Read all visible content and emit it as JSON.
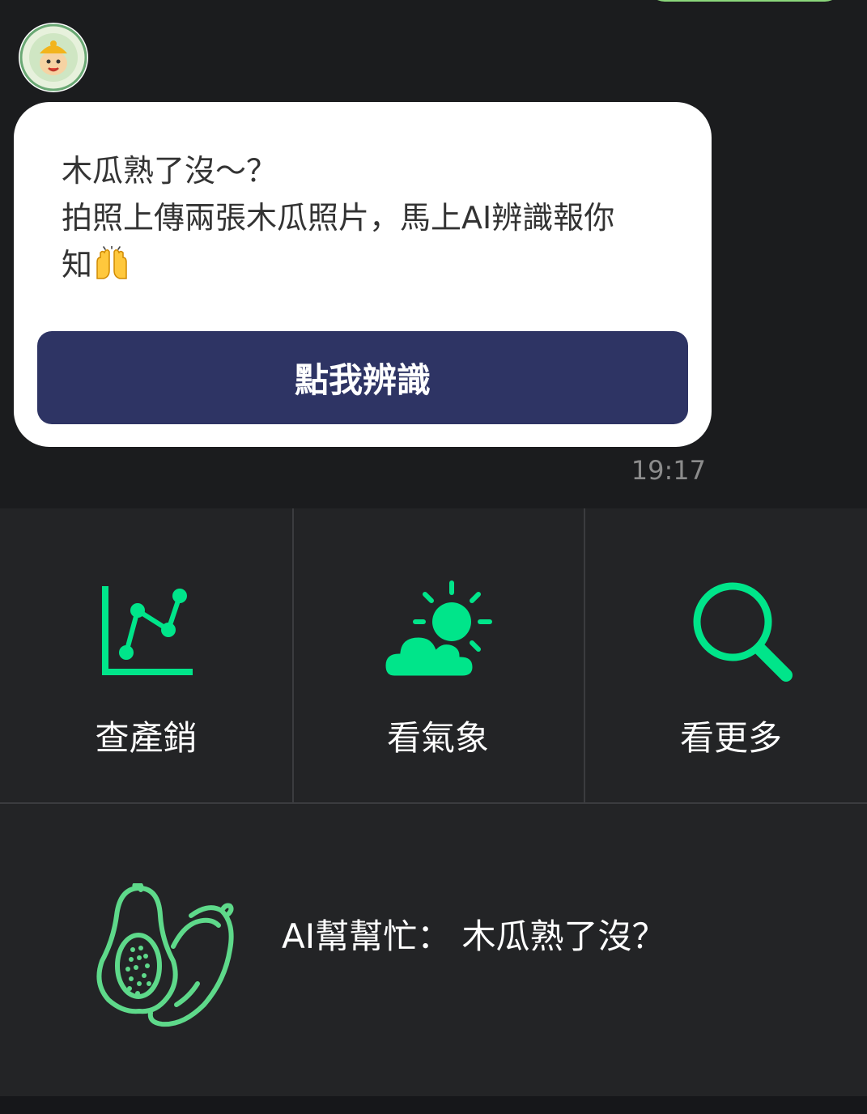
{
  "chat": {
    "message_text": "木瓜熟了沒～？\n拍照上傳兩張木瓜照片，馬上AI辨識報你\n知",
    "emoji_icon": "raising-hands-icon",
    "button_label": "點我辨識",
    "timestamp": "19:17"
  },
  "menu": {
    "items": [
      {
        "label": "查產銷",
        "icon": "line-chart-icon"
      },
      {
        "label": "看氣象",
        "icon": "weather-sun-cloud-icon"
      },
      {
        "label": "看更多",
        "icon": "search-icon"
      },
      {
        "label": "AI幫幫忙： 木瓜熟了沒？",
        "icon": "papaya-icon"
      }
    ]
  },
  "colors": {
    "accent": "#00e58a",
    "button_bg": "#2e3464",
    "papaya_icon": "#5ed98a",
    "chat_bg": "#1b1c1e",
    "menu_bg": "#232426"
  }
}
